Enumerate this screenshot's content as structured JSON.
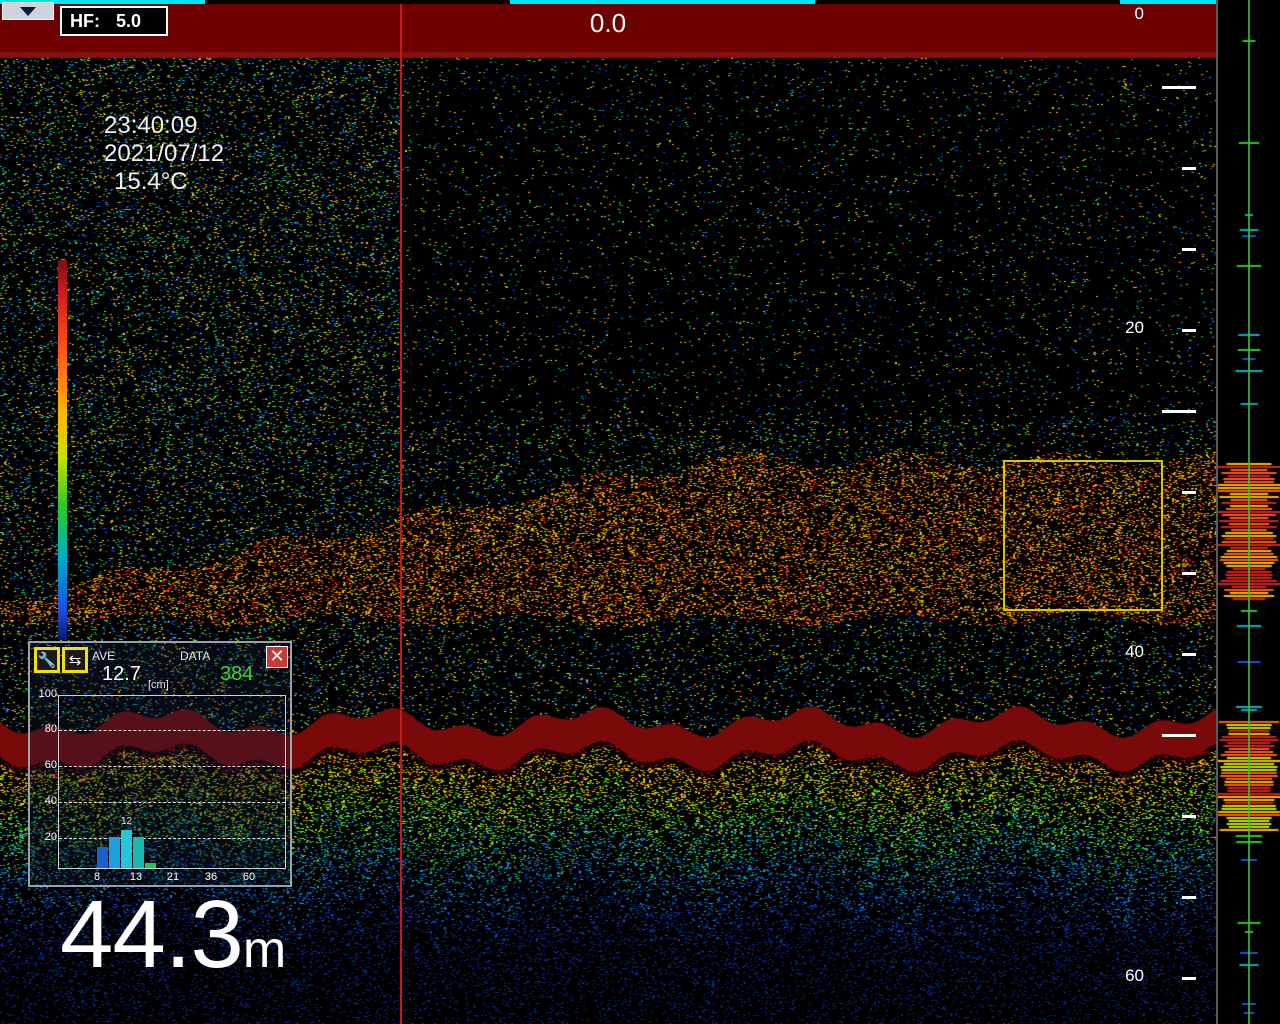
{
  "header": {
    "hf_label": "HF:",
    "hf_value": "5.0",
    "center_value": "0.0"
  },
  "info": {
    "time": "23:40:09",
    "date": "2021/07/12",
    "temperature": "15.4°C"
  },
  "depth_scale": {
    "labels": [
      "0",
      "20",
      "40",
      "60"
    ]
  },
  "fish_size_panel": {
    "ave_label": "AVE",
    "ave_value": "12.7",
    "unit": "[cm]",
    "data_label": "DATA",
    "data_value": "384",
    "y_ticks": [
      "100",
      "80",
      "60",
      "40",
      "20"
    ],
    "x_ticks": [
      "8",
      "13",
      "21",
      "36",
      "60"
    ],
    "peak_label": "12",
    "bars": [
      {
        "value": 12,
        "color": "#1d5fd0"
      },
      {
        "value": 18,
        "color": "#1e9fe0"
      },
      {
        "value": 22,
        "color": "#23c8d8"
      },
      {
        "value": 18,
        "color": "#1cb8b0"
      },
      {
        "value": 3,
        "color": "#22c85a"
      }
    ],
    "bar_max": 100
  },
  "current_depth": {
    "value": "44.3",
    "unit": "m"
  },
  "colors": {
    "topbar": "#6e0000",
    "accent_cyan": "#00e5f0",
    "ship_line": "#c41a1a",
    "target_box": "#d9c400",
    "data_count": "#3ad83a"
  }
}
